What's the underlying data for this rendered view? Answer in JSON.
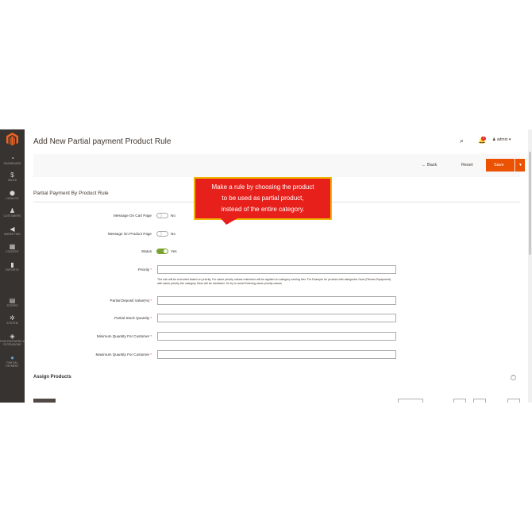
{
  "sidebar": {
    "logo": "magento-logo",
    "items": [
      {
        "label": "DASHBOARD",
        "icon": "dashboard-icon",
        "glyph": "◔"
      },
      {
        "label": "SALES",
        "icon": "dollar-icon",
        "glyph": "$"
      },
      {
        "label": "CATALOG",
        "icon": "cube-icon",
        "glyph": "⬢"
      },
      {
        "label": "CUSTOMERS",
        "icon": "person-icon",
        "glyph": "♟"
      },
      {
        "label": "MARKETING",
        "icon": "megaphone-icon",
        "glyph": "◀"
      },
      {
        "label": "CONTENT",
        "icon": "layout-icon",
        "glyph": "▦"
      },
      {
        "label": "REPORTS",
        "icon": "bar-chart-icon",
        "glyph": "▮"
      },
      {
        "label": "STORES",
        "icon": "store-icon",
        "glyph": "▤"
      },
      {
        "label": "SYSTEM",
        "icon": "gear-icon",
        "glyph": "✲"
      },
      {
        "label": "FIND PARTNERS & EXTENSIONS",
        "icon": "partners-icon",
        "glyph": "◈"
      },
      {
        "label": "PARTIAL PAYMENT",
        "icon": "partial-payment-icon",
        "glyph": "●"
      }
    ]
  },
  "header": {
    "title": "Add New Partial payment Product Rule",
    "notifications_count": "4",
    "user": "admin ▾"
  },
  "actions": {
    "back": "← Back",
    "reset": "Reset",
    "save": "Save",
    "save_arrow": "▼"
  },
  "form": {
    "section_title": "Partial Payment By Product Rule",
    "message_cart_label": "Message On Cart Page",
    "message_cart_value": "No",
    "message_product_label": "Message On Product Page",
    "message_product_value": "No",
    "status_label": "Status",
    "status_value": "Yes",
    "priority_label": "Priority",
    "priority_note": "The rule will be executed based on priority. For same priority values restriction will be applied on category coming first. For Example for product with categories Gear (Fitness Equipment) with same priority the category Gear will be restricted. So try to avoid Entering same priority values.",
    "deposit_label": "Partial Deposit Value(%)",
    "stock_label": "Partial Stock Quantity",
    "min_qty_label": "Minimum Quantity For Customer",
    "max_qty_label": "Maximum Quantity For Customer",
    "required_mark": "*"
  },
  "callout": {
    "line1": "Make a rule by choosing the product",
    "line2": "to be used as partial product,",
    "line3": "instead of the entire category."
  },
  "assign": {
    "title": "Assign Products",
    "toggle": "⌃"
  },
  "colors": {
    "sidebar": "#373330",
    "accent": "#eb5202",
    "toggle_on": "#79a22e",
    "callout": "#e8201c"
  }
}
